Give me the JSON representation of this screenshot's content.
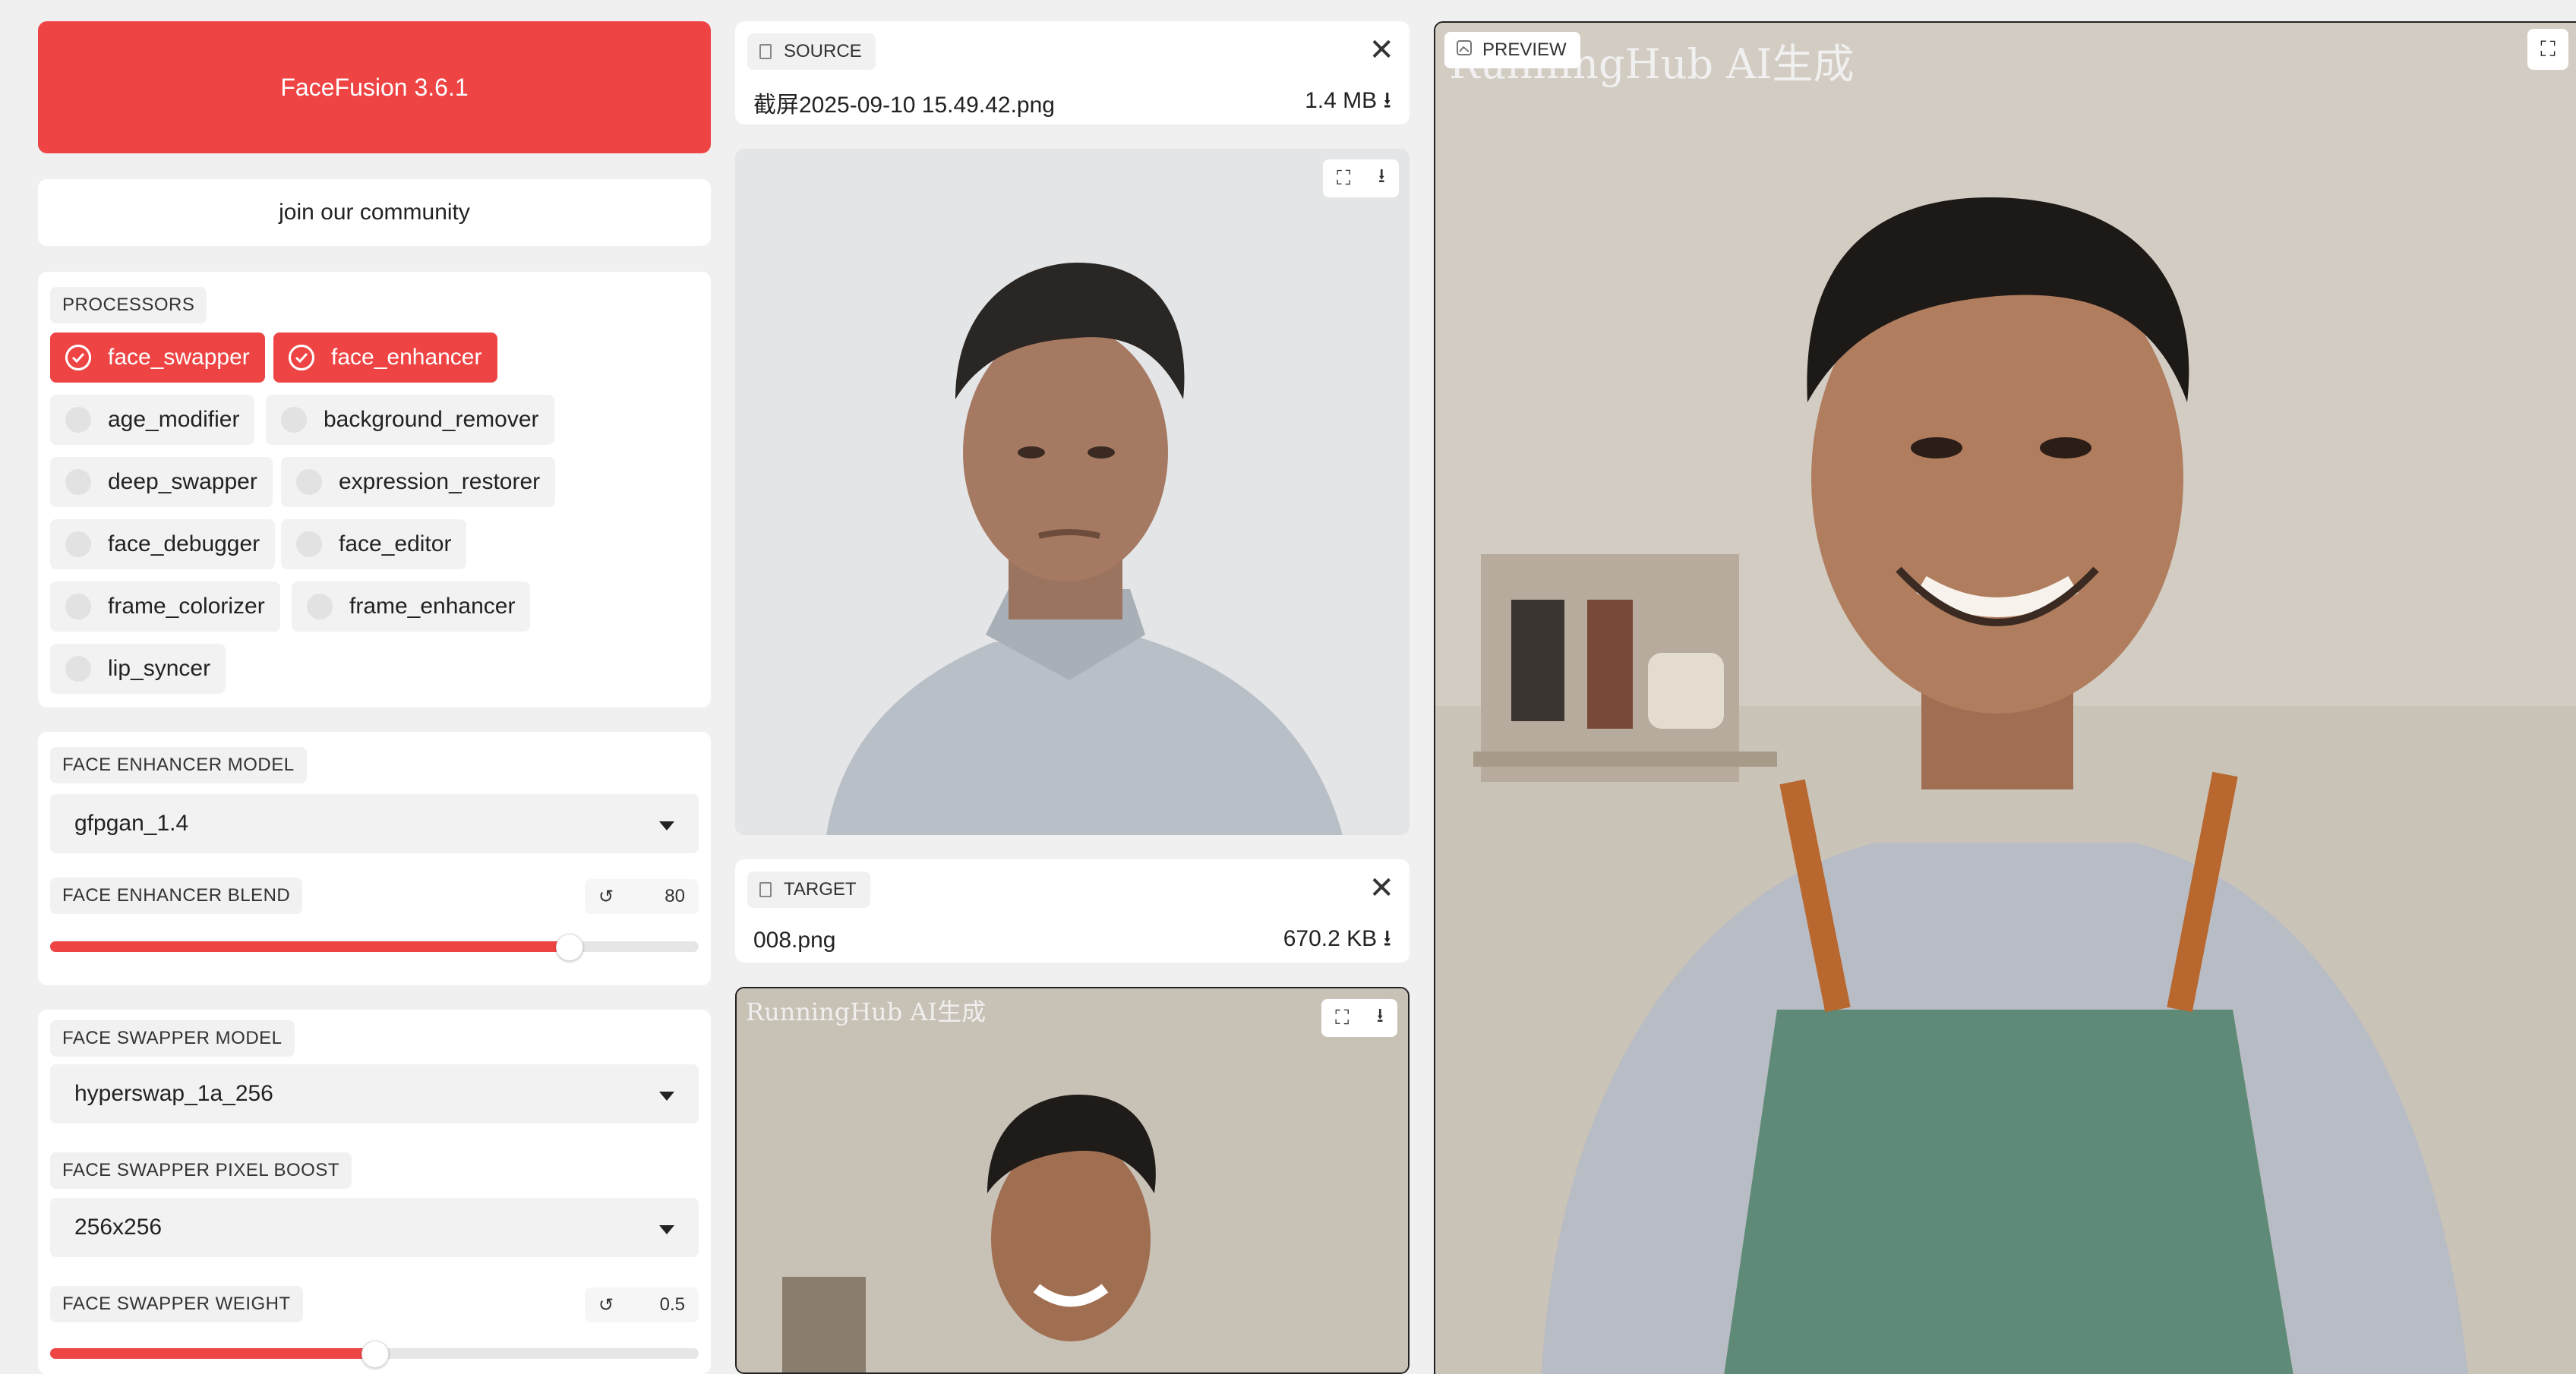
{
  "app": {
    "title": "FaceFusion 3.6.1",
    "community_label": "join our community",
    "accent_color": "#ef4444"
  },
  "processors": {
    "label": "PROCESSORS",
    "items": [
      {
        "name": "face_swapper",
        "checked": true
      },
      {
        "name": "face_enhancer",
        "checked": true
      },
      {
        "name": "age_modifier",
        "checked": false
      },
      {
        "name": "background_remover",
        "checked": false
      },
      {
        "name": "deep_swapper",
        "checked": false
      },
      {
        "name": "expression_restorer",
        "checked": false
      },
      {
        "name": "face_debugger",
        "checked": false
      },
      {
        "name": "face_editor",
        "checked": false
      },
      {
        "name": "frame_colorizer",
        "checked": false
      },
      {
        "name": "frame_enhancer",
        "checked": false
      },
      {
        "name": "lip_syncer",
        "checked": false
      }
    ]
  },
  "face_enhancer": {
    "model_label": "FACE ENHANCER MODEL",
    "model_value": "gfpgan_1.4",
    "blend_label": "FACE ENHANCER BLEND",
    "blend_value": "80",
    "blend_fraction": 0.8,
    "reset_icon": "↺"
  },
  "face_swapper": {
    "model_label": "FACE SWAPPER MODEL",
    "model_value": "hyperswap_1a_256",
    "pixel_boost_label": "FACE SWAPPER PIXEL BOOST",
    "pixel_boost_value": "256x256",
    "weight_label": "FACE SWAPPER WEIGHT",
    "weight_value": "0.5",
    "weight_fraction": 0.5,
    "reset_icon": "↺"
  },
  "source": {
    "label": "SOURCE",
    "filename": "截屏2025-09-10 15.49.42.png",
    "size": "1.4 MB ⭳"
  },
  "target": {
    "label": "TARGET",
    "filename": "008.png",
    "size": "670.2 KB ⭳",
    "watermark": "RunningHub AI生成"
  },
  "preview": {
    "label": "PREVIEW",
    "watermark": "RunningHub AI生成"
  },
  "icons": {
    "close": "✕",
    "fullscreen": "⛶",
    "download": "⭳",
    "dropdown": "▼",
    "check": "✓"
  }
}
